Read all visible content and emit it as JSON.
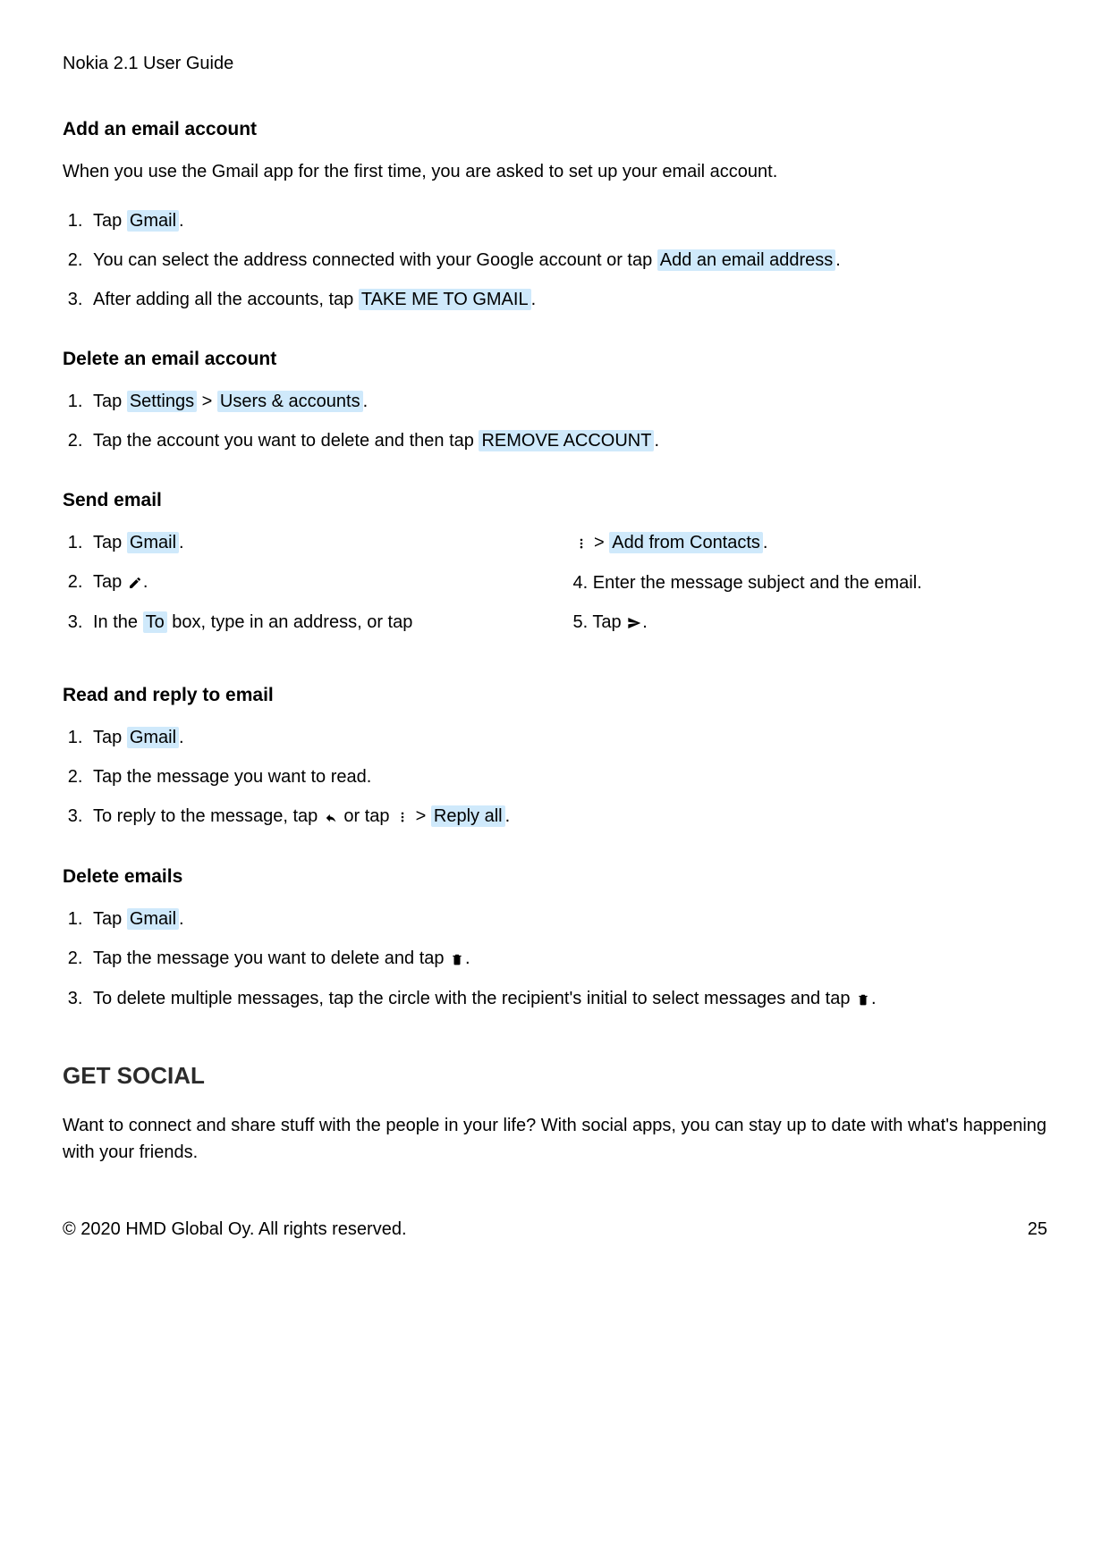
{
  "docTitle": "Nokia 2.1 User Guide",
  "addAccount": {
    "heading": "Add an email account",
    "intro": "When you use the Gmail app for the first time, you are asked to set up your email account.",
    "s1a": "Tap ",
    "s1hl": "Gmail",
    "s1b": ".",
    "s2a": "You can select the address connected with your Google account or tap ",
    "s2hl": "Add an email address",
    "s2b": ".",
    "s3a": "After adding all the accounts, tap ",
    "s3hl": "TAKE ME TO GMAIL",
    "s3b": "."
  },
  "deleteAccount": {
    "heading": "Delete an email account",
    "s1a": "Tap ",
    "s1hl1": "Settings",
    "s1sep": " > ",
    "s1hl2": "Users & accounts",
    "s1b": ".",
    "s2a": "Tap the account you want to delete and then tap ",
    "s2hl": "REMOVE ACCOUNT",
    "s2b": "."
  },
  "sendEmail": {
    "heading": "Send email",
    "s1a": "Tap ",
    "s1hl": "Gmail",
    "s1b": ".",
    "s2a": "Tap ",
    "s2b": ".",
    "s3a": "In the ",
    "s3hl": "To",
    "s3b": " box, type in an address, or tap",
    "s3c": " > ",
    "s3hl2": "Add from Contacts",
    "s3d": ".",
    "s4": "Enter the message subject and the email.",
    "s5a": "Tap ",
    "s5b": "."
  },
  "readReply": {
    "heading": "Read and reply to email",
    "s1a": "Tap ",
    "s1hl": "Gmail",
    "s1b": ".",
    "s2": "Tap the message you want to read.",
    "s3a": "To reply to the message, tap ",
    "s3b": " or tap ",
    "s3c": " > ",
    "s3hl": "Reply all",
    "s3d": "."
  },
  "deleteEmails": {
    "heading": "Delete emails",
    "s1a": "Tap ",
    "s1hl": "Gmail",
    "s1b": ".",
    "s2a": "Tap the message you want to delete and tap ",
    "s2b": ".",
    "s3a": "To delete multiple messages, tap the circle with the recipient's initial to select messages and tap ",
    "s3b": "."
  },
  "getSocial": {
    "heading": "GET SOCIAL",
    "body": "Want to connect and share stuff with the people in your life? With social apps, you can stay up to date with what's happening with your friends."
  },
  "footer": {
    "copyright": "© 2020 HMD Global Oy. All rights reserved.",
    "page": "25"
  },
  "marker4": "4.  ",
  "marker5": "5.  "
}
